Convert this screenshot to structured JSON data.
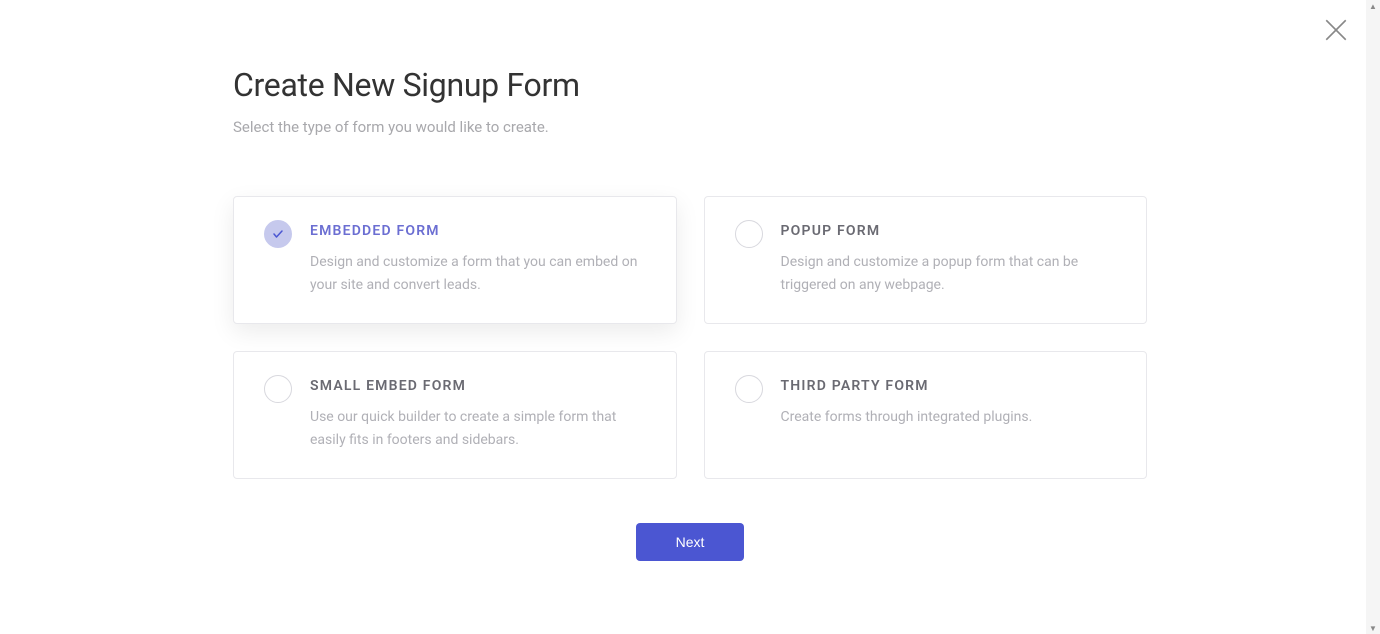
{
  "header": {
    "title": "Create New Signup Form",
    "subtitle": "Select the type of form you would like to create."
  },
  "options": {
    "embedded": {
      "title": "EMBEDDED FORM",
      "description": "Design and customize a form that you can embed on your site and convert leads.",
      "selected": true
    },
    "popup": {
      "title": "POPUP FORM",
      "description": "Design and customize a popup form that can be triggered on any webpage.",
      "selected": false
    },
    "small_embed": {
      "title": "SMALL EMBED FORM",
      "description": "Use our quick builder to create a simple form that easily fits in footers and sidebars.",
      "selected": false
    },
    "third_party": {
      "title": "THIRD PARTY FORM",
      "description": "Create forms through integrated plugins.",
      "selected": false
    }
  },
  "actions": {
    "next_label": "Next"
  }
}
